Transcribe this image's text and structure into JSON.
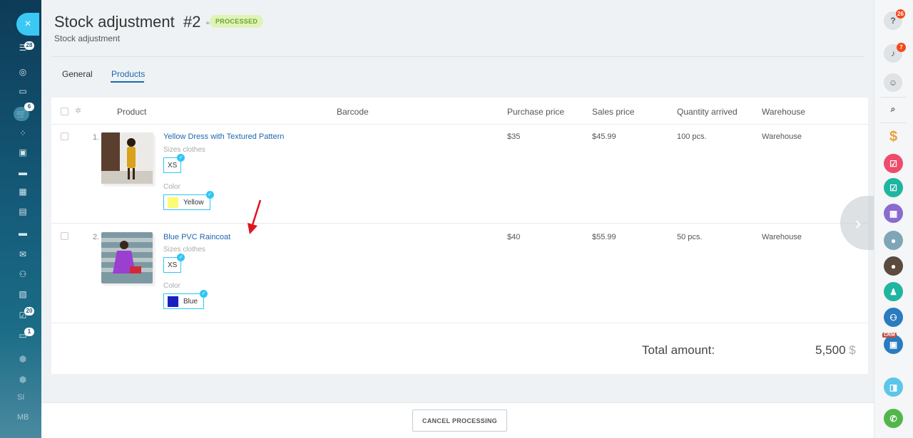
{
  "left_sidebar": {
    "close_icon": "×",
    "badges": {
      "filter": "28",
      "cart": "6",
      "tasks": "20",
      "chat": "1"
    },
    "labels": {
      "si": "SI",
      "mb": "MB"
    }
  },
  "header": {
    "title": "Stock adjustment",
    "doc_number": "#2",
    "status": "PROCESSED",
    "subtitle": "Stock adjustment"
  },
  "tabs": [
    {
      "label": "General",
      "active": false
    },
    {
      "label": "Products",
      "active": true
    }
  ],
  "table": {
    "columns": [
      "Product",
      "Barcode",
      "Purchase price",
      "Sales price",
      "Quantity arrived",
      "Warehouse"
    ],
    "rows": [
      {
        "num": "1.",
        "name": "Yellow Dress with Textured Pattern",
        "size_label": "Sizes clothes",
        "size": "XS",
        "color_label": "Color",
        "color": "Yellow",
        "color_hex": "#fdfb73",
        "barcode": "",
        "purchase_price": "$35",
        "sales_price": "$45.99",
        "quantity": "100 pcs.",
        "warehouse": "Warehouse"
      },
      {
        "num": "2.",
        "name": "Blue PVC Raincoat",
        "size_label": "Sizes clothes",
        "size": "XS",
        "color_label": "Color",
        "color": "Blue",
        "color_hex": "#1a1fc0",
        "barcode": "",
        "purchase_price": "$40",
        "sales_price": "$55.99",
        "quantity": "50 pcs.",
        "warehouse": "Warehouse"
      }
    ],
    "total_label": "Total amount:",
    "total_value": "5,500",
    "total_currency": "$"
  },
  "footer": {
    "cancel_label": "CANCEL PROCESSING"
  },
  "right_sidebar": {
    "help_badge": "26",
    "notifications_badge": "7",
    "crm_label": "CRM"
  },
  "colors": {
    "accent": "#2067b0",
    "status_bg": "#dff3b9",
    "status_text": "#6ba52f",
    "chip_border": "#2fc6f6"
  }
}
